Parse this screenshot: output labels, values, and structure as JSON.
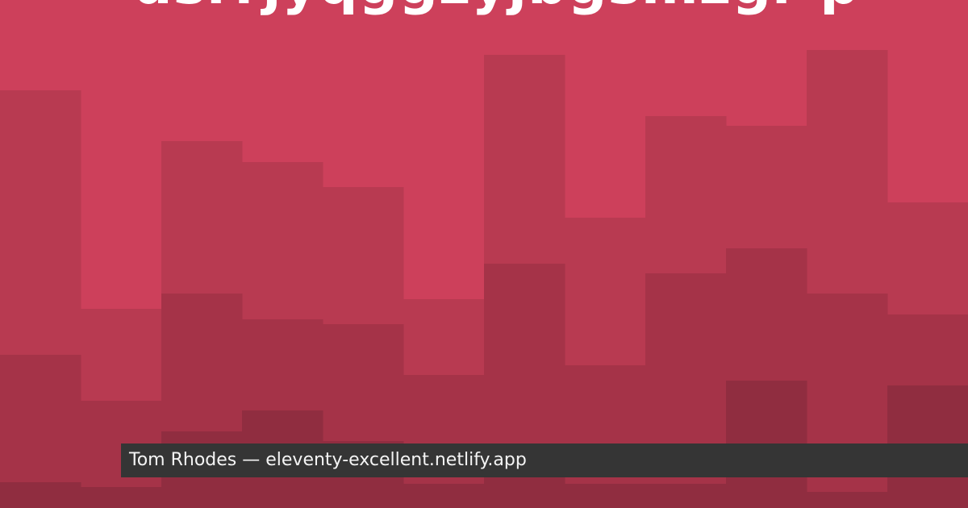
{
  "card": {
    "title": "dsrrjyqggzyjbgsmzgr p",
    "author": "Tom Rhodes",
    "separator": "—",
    "site": "eleventy-excellent.netlify.app"
  },
  "colors": {
    "background": "#cd405b",
    "layer_1": "#b83a51",
    "layer_2": "#a53348",
    "layer_3": "#902d40",
    "footer_bar": "#353535",
    "title_text": "#ffffff",
    "footer_text": "#f4f4f4"
  }
}
